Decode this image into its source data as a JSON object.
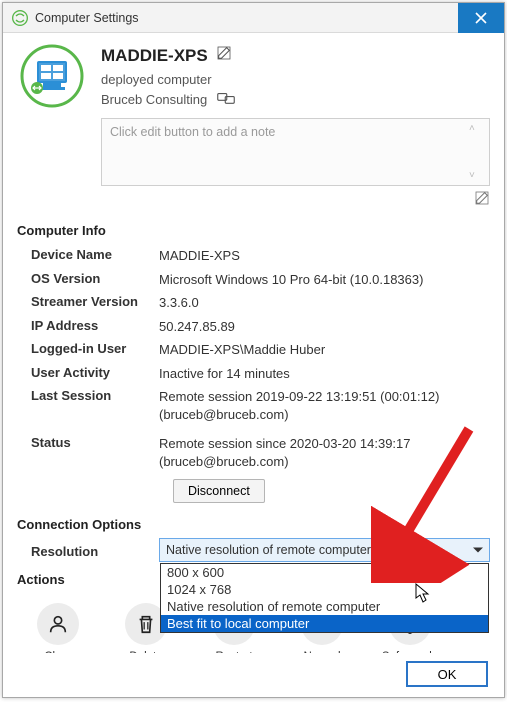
{
  "window": {
    "title": "Computer Settings"
  },
  "header": {
    "computer_name": "MADDIE-XPS",
    "status_line": "deployed computer",
    "group": "Bruceb Consulting"
  },
  "note": {
    "placeholder": "Click edit button to add a note"
  },
  "sections": {
    "computer_info": "Computer Info",
    "connection_options": "Connection Options",
    "actions": "Actions"
  },
  "info": {
    "rows": [
      {
        "label": "Device Name",
        "value": "MADDIE-XPS"
      },
      {
        "label": "OS Version",
        "value": "Microsoft Windows 10 Pro 64-bit (10.0.18363)"
      },
      {
        "label": "Streamer Version",
        "value": "3.3.6.0"
      },
      {
        "label": "IP Address",
        "value": "50.247.85.89"
      },
      {
        "label": "Logged-in User",
        "value": "MADDIE-XPS\\Maddie Huber"
      },
      {
        "label": "User Activity",
        "value": "Inactive for 14 minutes"
      },
      {
        "label": "Last Session",
        "value": "Remote session 2019-09-22 13:19:51 (00:01:12) (bruceb@bruceb.com)"
      },
      {
        "label": "Status",
        "value": "Remote session since 2020-03-20 14:39:17 (bruceb@bruceb.com)"
      }
    ],
    "disconnect": "Disconnect"
  },
  "resolution": {
    "label": "Resolution",
    "selected": "Native resolution of remote computer",
    "options": [
      "800 x 600",
      "1024 x 768",
      "Native resolution of remote computer",
      "Best fit to local computer"
    ],
    "highlighted_index": 3
  },
  "actions": [
    {
      "icon": "user",
      "label": "Clear Credentials"
    },
    {
      "icon": "trash",
      "label": "Delete Computer"
    },
    {
      "icon": "cycle",
      "label": "Restart Streamer"
    },
    {
      "icon": "power",
      "label": "Normal Reboot"
    },
    {
      "icon": "shield",
      "label": "Safe-mode Reboot"
    }
  ],
  "footer": {
    "ok": "OK"
  },
  "colors": {
    "titlebar_close": "#1979c3",
    "accent": "#0a64c8",
    "icon_green": "#59b74a"
  }
}
